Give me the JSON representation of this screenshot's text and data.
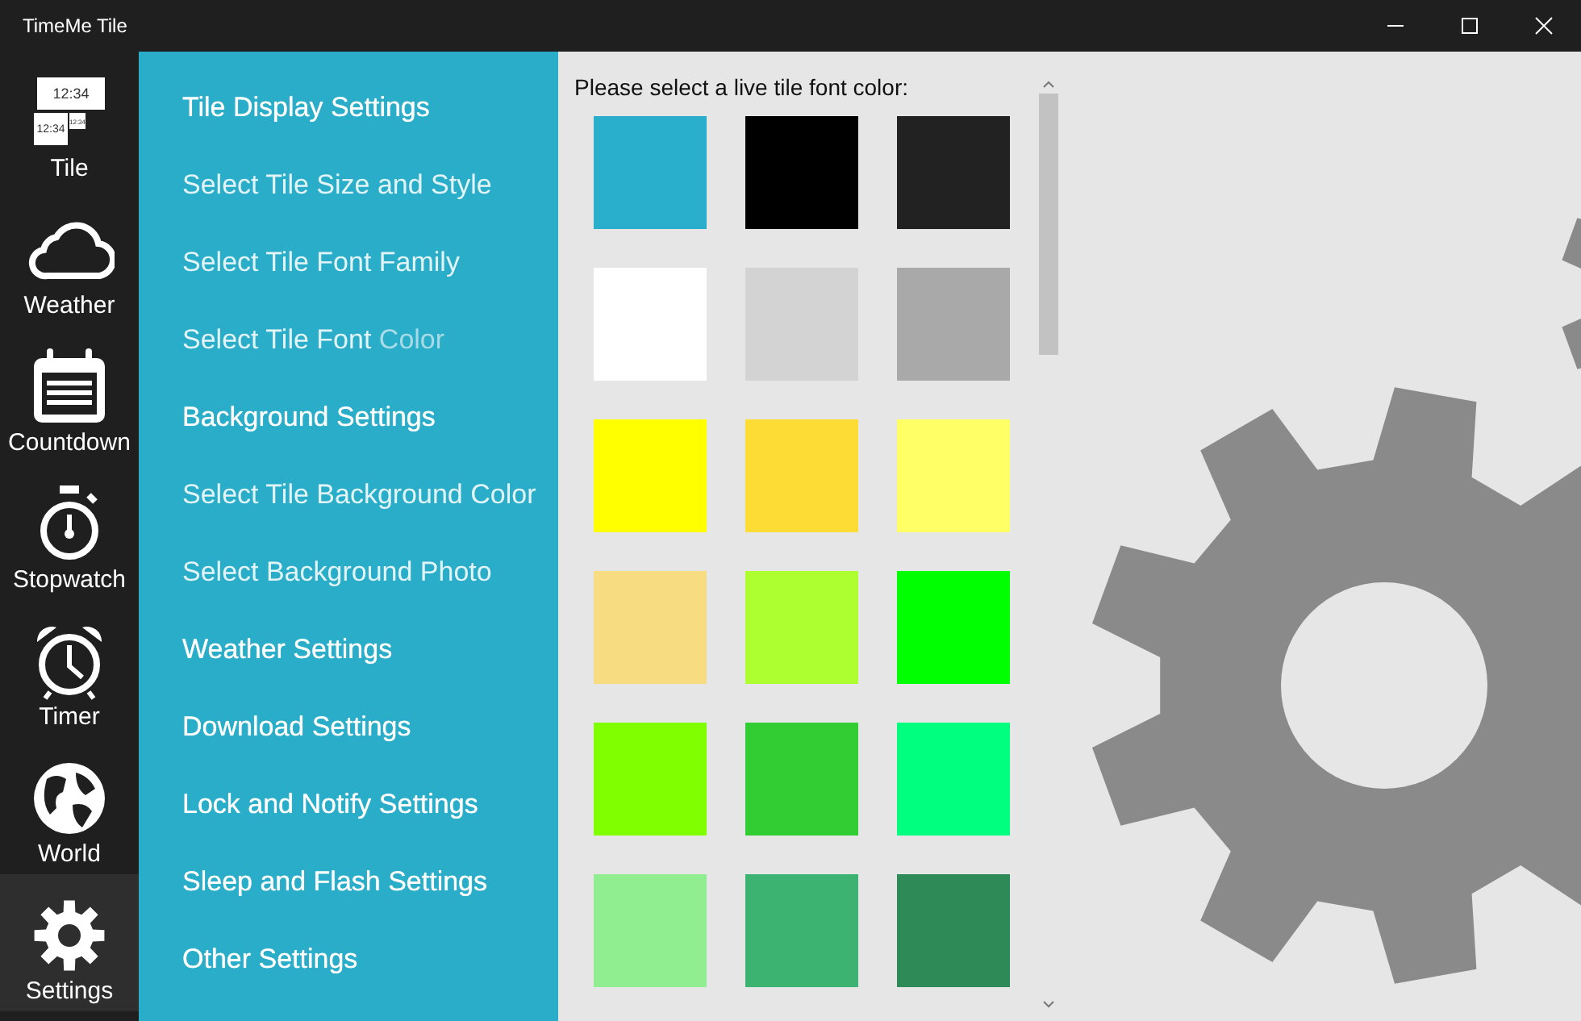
{
  "window": {
    "title": "TimeMe Tile"
  },
  "nav": [
    {
      "label": "Tile",
      "kind": "tile",
      "selected": false,
      "icon_texts": [
        "12:34",
        "12:34",
        "12:34"
      ]
    },
    {
      "label": "Weather",
      "kind": "cloud",
      "selected": false
    },
    {
      "label": "Countdown",
      "kind": "calendar",
      "selected": false
    },
    {
      "label": "Stopwatch",
      "kind": "stopwatch",
      "selected": false
    },
    {
      "label": "Timer",
      "kind": "alarm",
      "selected": false
    },
    {
      "label": "World",
      "kind": "globe",
      "selected": false
    },
    {
      "label": "Settings",
      "kind": "gear",
      "selected": true
    }
  ],
  "menu": [
    {
      "label": "Tile Display Settings",
      "kind": "header"
    },
    {
      "label": "Select Tile Size and Style",
      "kind": "option"
    },
    {
      "label": "Select Tile Font Family",
      "kind": "option"
    },
    {
      "label": "Select Tile Font",
      "highlight": "Color",
      "kind": "option"
    },
    {
      "label": "Background Settings",
      "kind": "header"
    },
    {
      "label": "Select Tile Background Color",
      "kind": "option"
    },
    {
      "label": "Select Background Photo",
      "kind": "option"
    },
    {
      "label": "Weather Settings",
      "kind": "header"
    },
    {
      "label": "Download Settings",
      "kind": "header"
    },
    {
      "label": "Lock and Notify Settings",
      "kind": "header"
    },
    {
      "label": "Sleep and Flash Settings",
      "kind": "header"
    },
    {
      "label": "Other Settings",
      "kind": "header"
    }
  ],
  "color_picker": {
    "prompt": "Please select a live tile font color:",
    "swatches": [
      {
        "color": "#29aecb"
      },
      {
        "color": "#000000"
      },
      {
        "color": "#222222"
      },
      {
        "color": "#ffffff"
      },
      {
        "color": "#d3d3d3"
      },
      {
        "color": "#a9a9a9"
      },
      {
        "color": "#ffff00"
      },
      {
        "color": "#fddc36"
      },
      {
        "color": "#ffff66"
      },
      {
        "color": "#f8dc82"
      },
      {
        "color": "#adff2f"
      },
      {
        "color": "#00ff00"
      },
      {
        "color": "#7fff00"
      },
      {
        "color": "#32cd32"
      },
      {
        "color": "#00ff7f"
      },
      {
        "color": "#90ee90"
      },
      {
        "color": "#3cb371"
      },
      {
        "color": "#2e8b57"
      }
    ]
  }
}
